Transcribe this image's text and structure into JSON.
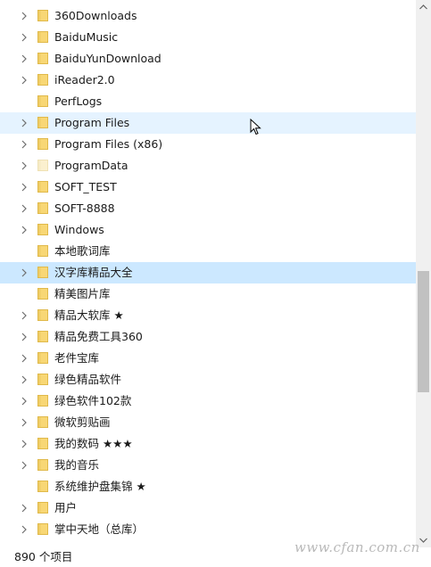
{
  "folders": [
    {
      "label": "360Downloads",
      "expandable": true,
      "variant": "normal",
      "state": ""
    },
    {
      "label": "BaiduMusic",
      "expandable": true,
      "variant": "normal",
      "state": ""
    },
    {
      "label": "BaiduYunDownload",
      "expandable": true,
      "variant": "normal",
      "state": ""
    },
    {
      "label": "iReader2.0",
      "expandable": true,
      "variant": "normal",
      "state": ""
    },
    {
      "label": "PerfLogs",
      "expandable": false,
      "variant": "normal",
      "state": ""
    },
    {
      "label": "Program Files",
      "expandable": true,
      "variant": "normal",
      "state": "hover"
    },
    {
      "label": "Program Files (x86)",
      "expandable": true,
      "variant": "normal",
      "state": ""
    },
    {
      "label": "ProgramData",
      "expandable": true,
      "variant": "hidden",
      "state": ""
    },
    {
      "label": "SOFT_TEST",
      "expandable": true,
      "variant": "normal",
      "state": ""
    },
    {
      "label": "SOFT-8888",
      "expandable": true,
      "variant": "normal",
      "state": ""
    },
    {
      "label": "Windows",
      "expandable": true,
      "variant": "normal",
      "state": ""
    },
    {
      "label": "本地歌词库",
      "expandable": false,
      "variant": "normal",
      "state": ""
    },
    {
      "label": "汉字库精品大全",
      "expandable": true,
      "variant": "normal",
      "state": "selected"
    },
    {
      "label": "精美图片库",
      "expandable": false,
      "variant": "normal",
      "state": ""
    },
    {
      "label": "精品大软库 ★",
      "expandable": true,
      "variant": "normal",
      "state": ""
    },
    {
      "label": "精品免费工具360",
      "expandable": true,
      "variant": "normal",
      "state": ""
    },
    {
      "label": "老件宝库",
      "expandable": true,
      "variant": "normal",
      "state": ""
    },
    {
      "label": "绿色精品软件",
      "expandable": true,
      "variant": "normal",
      "state": ""
    },
    {
      "label": "绿色软件102款",
      "expandable": true,
      "variant": "normal",
      "state": ""
    },
    {
      "label": "微软剪贴画",
      "expandable": true,
      "variant": "normal",
      "state": ""
    },
    {
      "label": "我的数码 ★★★",
      "expandable": true,
      "variant": "normal",
      "state": ""
    },
    {
      "label": "我的音乐",
      "expandable": true,
      "variant": "normal",
      "state": ""
    },
    {
      "label": "系统维护盘集锦 ★",
      "expandable": false,
      "variant": "normal",
      "state": ""
    },
    {
      "label": "用户",
      "expandable": true,
      "variant": "normal",
      "state": ""
    },
    {
      "label": "掌中天地（总库）",
      "expandable": true,
      "variant": "normal",
      "state": ""
    }
  ],
  "status_bar": {
    "item_count": "890 个项目"
  },
  "watermark": "www.cfan.com.cn",
  "colors": {
    "folder": "#f8d775",
    "folder_edge": "#e0b94a",
    "folder_hidden": "#fbf0cf",
    "hover": "#e5f3ff",
    "selected": "#cce8ff",
    "chevron": "#6e6e6e"
  }
}
